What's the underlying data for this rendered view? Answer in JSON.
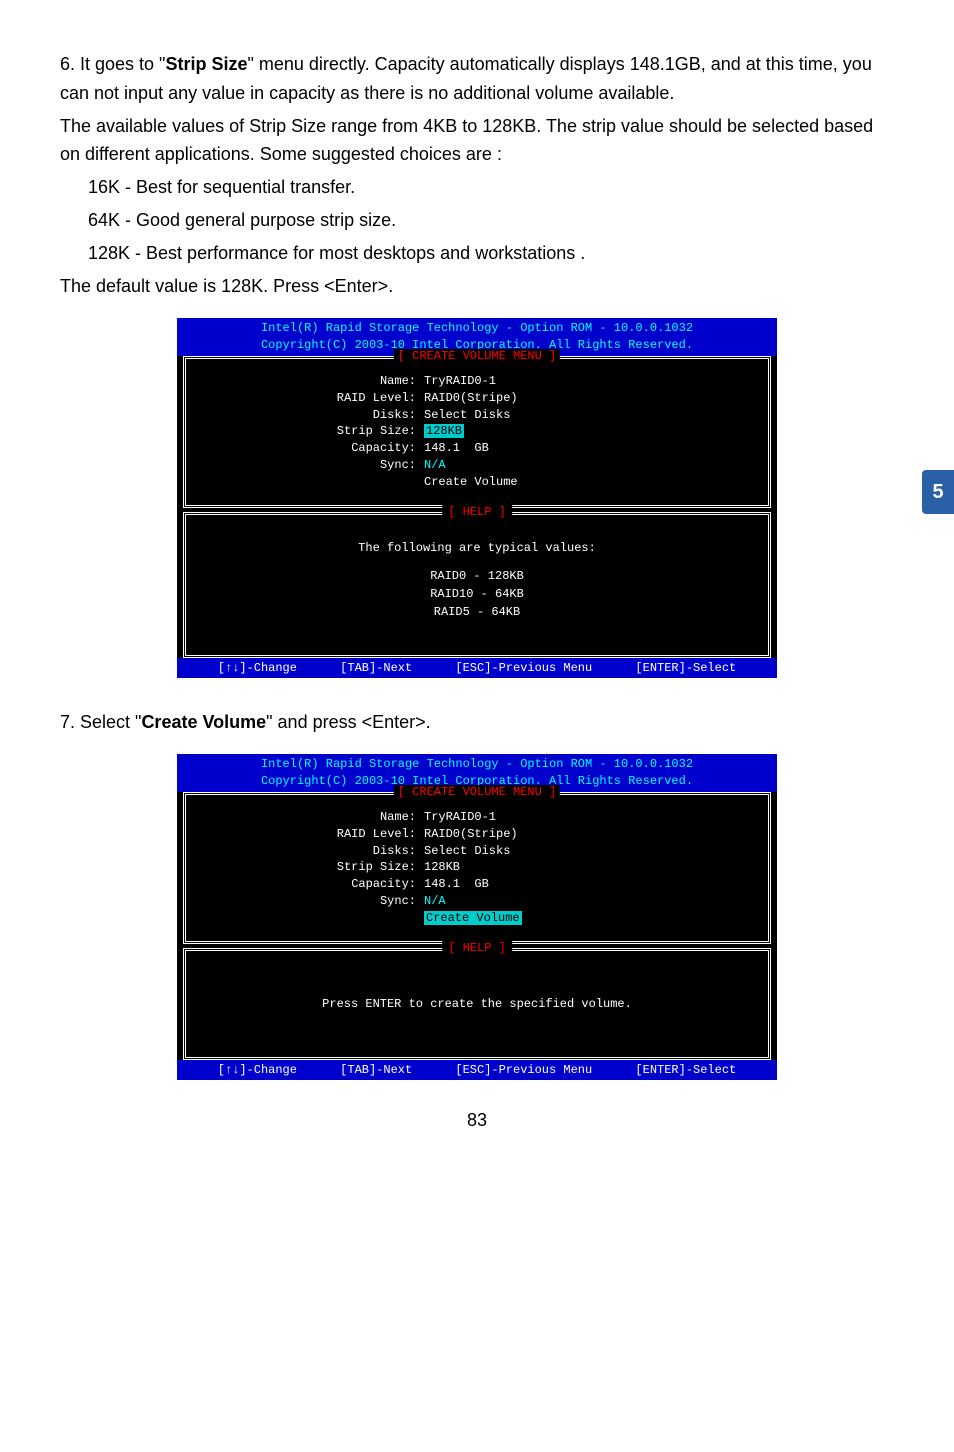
{
  "side_tab": "5",
  "page_number": "83",
  "para1": {
    "lead": "6. It goes to \"",
    "bold": "Strip Size",
    "tail": "\" menu directly. Capacity automatically displays 148.1GB, and at this time, you can not input any value in capacity as there is no additional volume available."
  },
  "para2": "The available values of Strip Size range from 4KB to 128KB. The strip value should be selected based on different applications. Some suggested choices are :",
  "bullets": {
    "b1": "16K - Best for sequential transfer.",
    "b2": "64K - Good general purpose strip size.",
    "b3": "128K - Best performance for most desktops and workstations ."
  },
  "para3": "The default value is 128K. Press <Enter>.",
  "para4": {
    "lead": "7. Select \"",
    "bold": "Create Volume",
    "tail": "\" and press <Enter>."
  },
  "bios": {
    "header1": "Intel(R) Rapid Storage Technology - Option ROM - 10.0.0.1032",
    "header2": "Copyright(C) 2003-10 Intel Corporation.   All Rights Reserved.",
    "panel_title": "[ CREATE VOLUME MENU ]",
    "help_title": "[ HELP ]",
    "labels": {
      "name": "Name:",
      "raid_level": "RAID Level:",
      "disks": "Disks:",
      "strip_size": "Strip Size:",
      "capacity": "Capacity:",
      "sync": "Sync:"
    },
    "values": {
      "name": "TryRAID0-1",
      "raid_level": "RAID0(Stripe)",
      "disks": "Select Disks",
      "strip_size": "128KB",
      "capacity_num": "148.1",
      "capacity_unit": "GB",
      "sync": "N/A",
      "create": "Create Volume"
    },
    "help1": {
      "line1": "The following are typical values:",
      "line2": "RAID0   -  128KB",
      "line3": "RAID10 -  64KB",
      "line4": "RAID5   -  64KB"
    },
    "help2": "Press ENTER to create the specified volume.",
    "footer": {
      "f1": "[↑↓]-Change",
      "f2": "[TAB]-Next",
      "f3": "[ESC]-Previous Menu",
      "f4": "[ENTER]-Select"
    }
  }
}
